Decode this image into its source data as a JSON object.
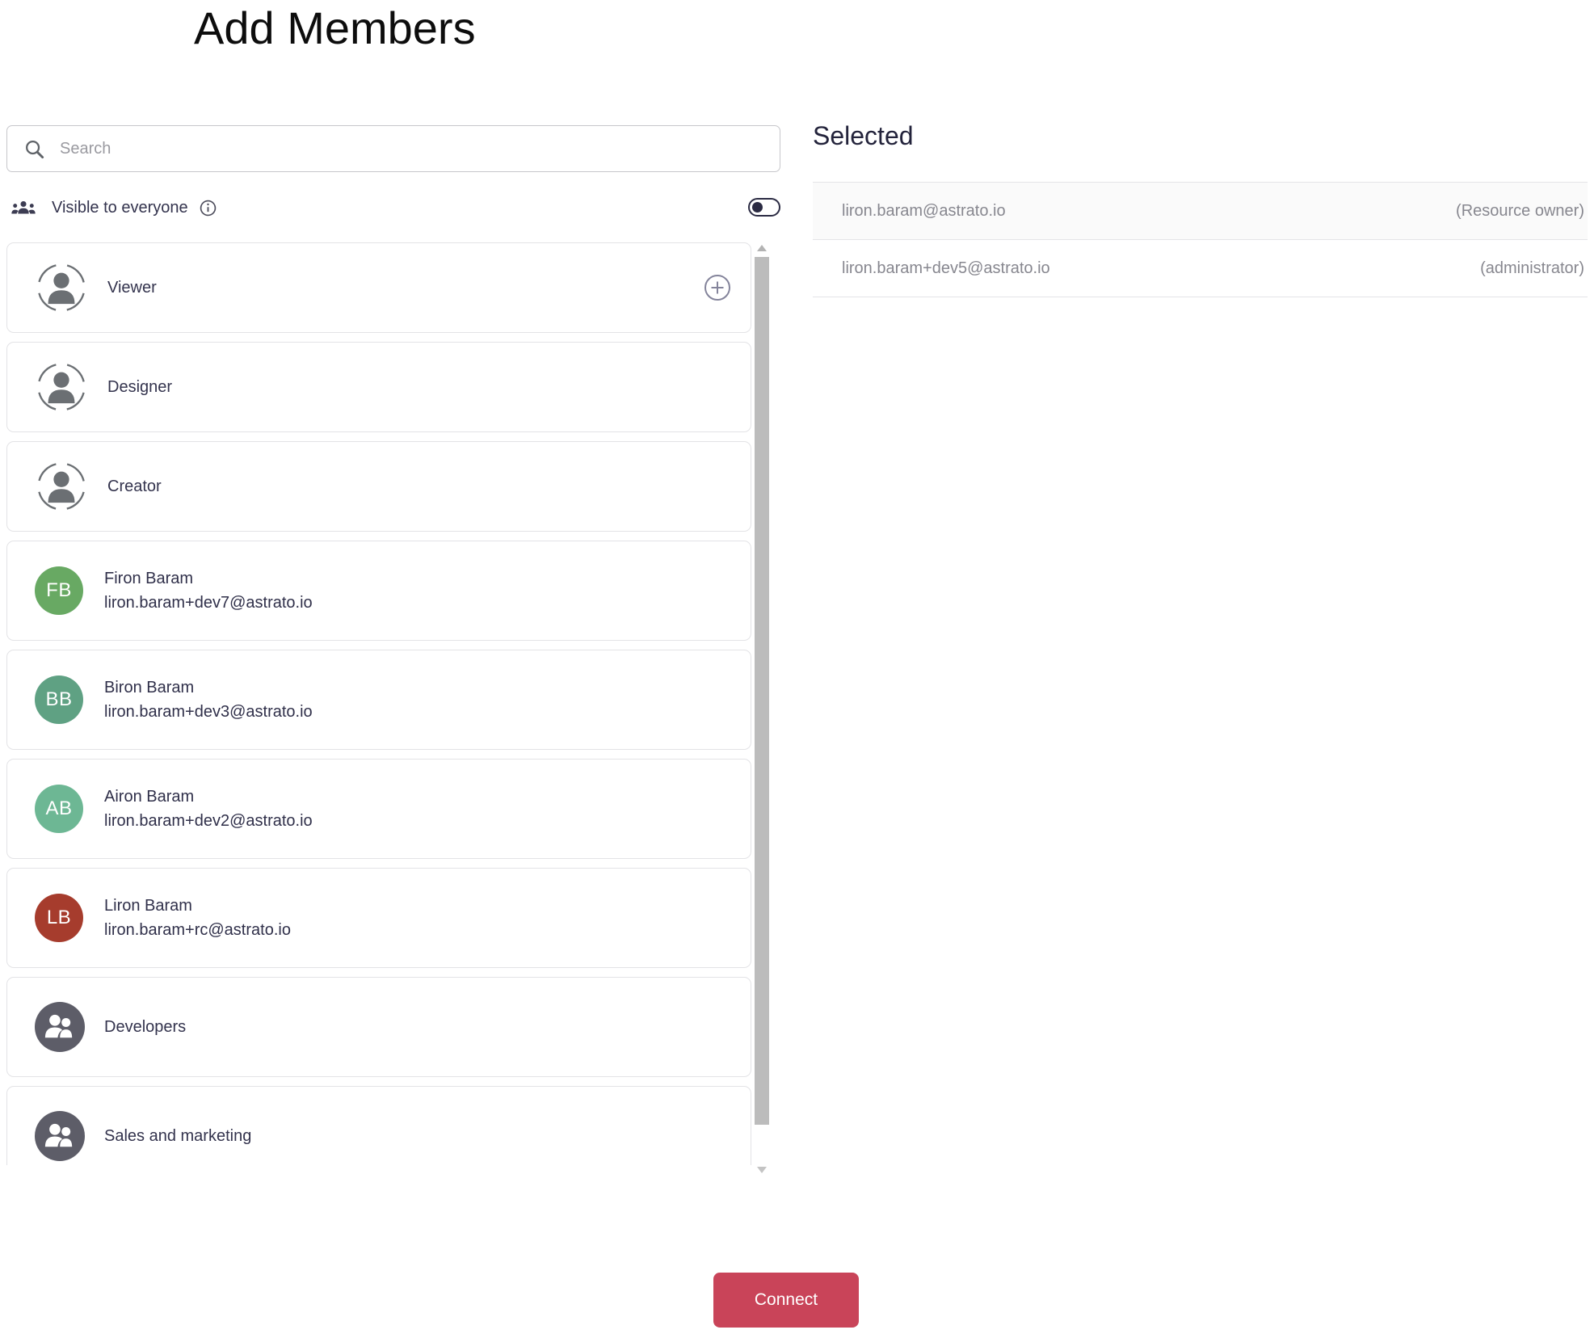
{
  "title": "Add Members",
  "search": {
    "placeholder": "Search"
  },
  "visibility": {
    "label": "Visible to everyone",
    "toggle_state": "off"
  },
  "roles": [
    {
      "label": "Viewer"
    },
    {
      "label": "Designer"
    },
    {
      "label": "Creator"
    }
  ],
  "users": [
    {
      "initials": "FB",
      "name": "Firon Baram",
      "email": "liron.baram+dev7@astrato.io",
      "avatar_color": "#68a963"
    },
    {
      "initials": "BB",
      "name": "Biron Baram",
      "email": "liron.baram+dev3@astrato.io",
      "avatar_color": "#5fa183"
    },
    {
      "initials": "AB",
      "name": "Airon Baram",
      "email": "liron.baram+dev2@astrato.io",
      "avatar_color": "#6db794"
    },
    {
      "initials": "LB",
      "name": "Liron Baram",
      "email": "liron.baram+rc@astrato.io",
      "avatar_color": "#a63c2d"
    }
  ],
  "groups": [
    {
      "label": "Developers"
    },
    {
      "label": "Sales and marketing"
    }
  ],
  "selected": {
    "heading": "Selected",
    "items": [
      {
        "email": "liron.baram@astrato.io",
        "role": "(Resource owner)"
      },
      {
        "email": "liron.baram+dev5@astrato.io",
        "role": "(administrator)"
      }
    ]
  },
  "footer": {
    "connect_label": "Connect"
  },
  "colors": {
    "connect_button": "#c94459",
    "group_avatar": "#5d5d68",
    "text_navy": "#30304a",
    "text_gray": "#87878f"
  }
}
